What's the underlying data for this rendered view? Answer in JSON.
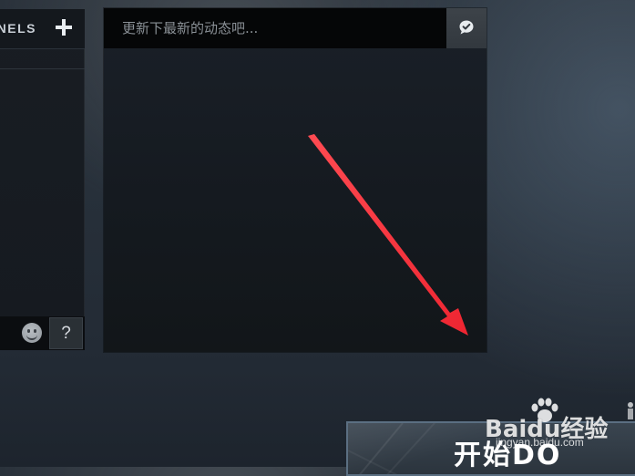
{
  "channels": {
    "title": "NELS"
  },
  "feed": {
    "status_placeholder": "更新下最新的动态吧..."
  },
  "chat_input": {
    "help_label": "?"
  },
  "play_button": {
    "label": "开始DO"
  },
  "watermark": {
    "text": "Baidu经验",
    "sub_text": "jingyan.baidu.com"
  },
  "colors": {
    "annotation_arrow": "#f4303a",
    "play_button_border": "#5b6f82",
    "input_background": "#050607"
  },
  "icons": {
    "add_channel": "plus-icon",
    "post": "chat-check-icon",
    "emoji": "smiley-icon",
    "watermark": "paw-icon"
  }
}
